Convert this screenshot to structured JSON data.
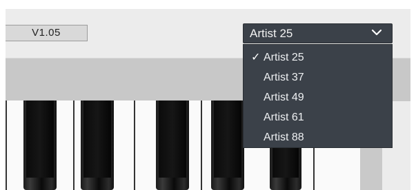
{
  "version": {
    "label": "V1.05"
  },
  "instrument_select": {
    "selected": "Artist 25",
    "options": [
      {
        "label": "Artist 25",
        "checked": true
      },
      {
        "label": "Artist 37",
        "checked": false
      },
      {
        "label": "Artist 49",
        "checked": false
      },
      {
        "label": "Artist 61",
        "checked": false
      },
      {
        "label": "Artist 88",
        "checked": false
      }
    ],
    "check_glyph": "✓",
    "icon": "chevron-down-icon"
  },
  "colors": {
    "dropdown_bg": "#3b4149",
    "panel_bg": "#ececec",
    "keyboard_strip": "#c8c8c8"
  }
}
